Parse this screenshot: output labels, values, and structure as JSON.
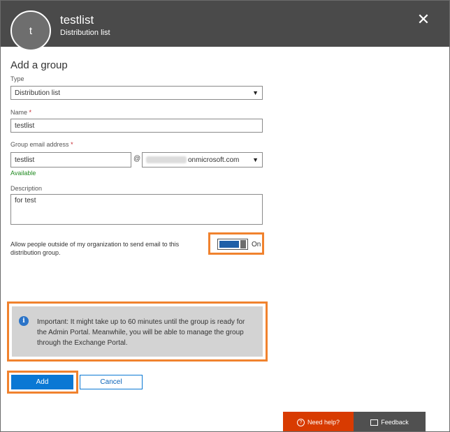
{
  "header": {
    "avatar_letter": "t",
    "title": "testlist",
    "subtitle": "Distribution list",
    "close_glyph": "✕"
  },
  "form": {
    "section_title": "Add a group",
    "type_label": "Type",
    "type_value": "Distribution list",
    "name_label": "Name",
    "required_marker": "*",
    "name_value": "testlist",
    "email_label": "Group email address",
    "email_value": "testlist",
    "at_sign": "@",
    "domain_value": "onmicrosoft.com",
    "availability": "Available",
    "description_label": "Description",
    "description_value": "for test",
    "allow_external_text": "Allow people outside of my organization to send email to this distribution group.",
    "toggle_label": "On",
    "toggle_on": true
  },
  "info": {
    "icon_glyph": "i",
    "text": "Important: It might take up to 60 minutes until the group is ready for the Admin Portal. Meanwhile, you will be able to manage the group through the Exchange Portal."
  },
  "buttons": {
    "add_label": "Add",
    "cancel_label": "Cancel"
  },
  "footer": {
    "help_label": "Need help?",
    "feedback_label": "Feedback"
  },
  "colors": {
    "header_bg": "#4a4a4a",
    "accent": "#0a78d4",
    "highlight": "#f0822e",
    "help_bg": "#d83b01",
    "available": "#218a21"
  },
  "icons": [
    "close-icon",
    "info-icon",
    "chevron-down-icon",
    "question-icon",
    "feedback-icon"
  ]
}
